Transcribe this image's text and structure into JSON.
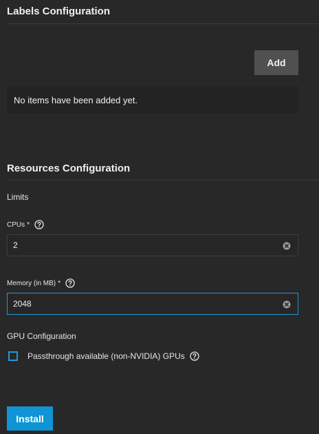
{
  "labels_section": {
    "title": "Labels Configuration",
    "add_label": "Add",
    "empty_message": "No items have been added yet."
  },
  "resources_section": {
    "title": "Resources Configuration",
    "limits_label": "Limits",
    "cpus": {
      "label": "CPUs",
      "required_marker": "*",
      "value": "2"
    },
    "memory": {
      "label": "Memory (in MB)",
      "required_marker": "*",
      "value": "2048"
    },
    "gpu": {
      "heading": "GPU Configuration",
      "passthrough_label": "Passthrough available (non-NVIDIA) GPUs",
      "passthrough_checked": false
    }
  },
  "footer": {
    "install_label": "Install"
  },
  "colors": {
    "background": "#282828",
    "accent": "#0f95d5",
    "focus_border": "#1e9ad6",
    "secondary_button": "#505050"
  },
  "icons": {
    "help": "help-circle-icon",
    "clear": "clear-circle-icon"
  }
}
